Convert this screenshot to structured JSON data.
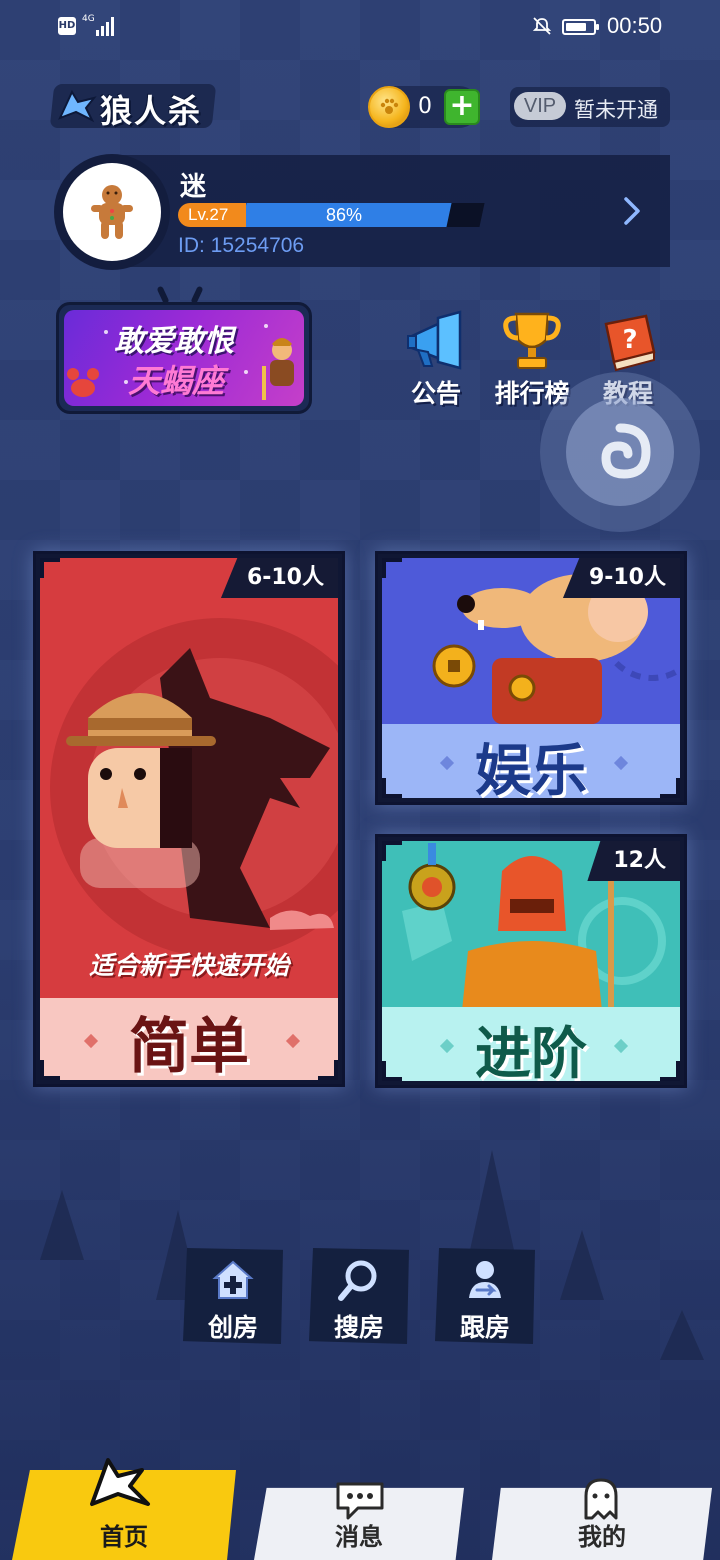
{
  "status_bar": {
    "hd": "HD",
    "network": "4G",
    "time": "00:50"
  },
  "header": {
    "app_name": "狼人杀",
    "coins": "0",
    "vip_badge": "VIP",
    "vip_status": "暂未开通"
  },
  "profile": {
    "name": "迷",
    "level": "Lv.27",
    "xp_percent_label": "86%",
    "xp_progress": 0.86,
    "user_id": "ID: 15254706"
  },
  "promo": {
    "line1": "敢爱敢恨",
    "line2": "天蝎座"
  },
  "quick_actions": [
    {
      "label": "公告",
      "icon": "megaphone-icon"
    },
    {
      "label": "排行榜",
      "icon": "trophy-icon"
    },
    {
      "label": "教程",
      "icon": "question-book-icon"
    }
  ],
  "modes": {
    "simple": {
      "count": "6-10人",
      "subtitle": "适合新手快速开始",
      "label": "简单"
    },
    "fun": {
      "count": "9-10人",
      "label": "娱乐"
    },
    "advanced": {
      "count": "12人",
      "label": "进阶"
    }
  },
  "room_actions": [
    {
      "label": "创房",
      "icon": "create-room-icon"
    },
    {
      "label": "搜房",
      "icon": "search-icon"
    },
    {
      "label": "跟房",
      "icon": "follow-room-icon"
    }
  ],
  "bottom_nav": [
    {
      "label": "首页",
      "active": true
    },
    {
      "label": "消息",
      "active": false
    },
    {
      "label": "我的",
      "active": false
    }
  ],
  "colors": {
    "accent_yellow": "#f9c90f",
    "xp_blue": "#2f7fe6",
    "level_orange": "#f28a1c",
    "simple_red": "#d63c3f",
    "fun_blue": "#4e5ad9",
    "advanced_teal": "#3fbfb8"
  }
}
